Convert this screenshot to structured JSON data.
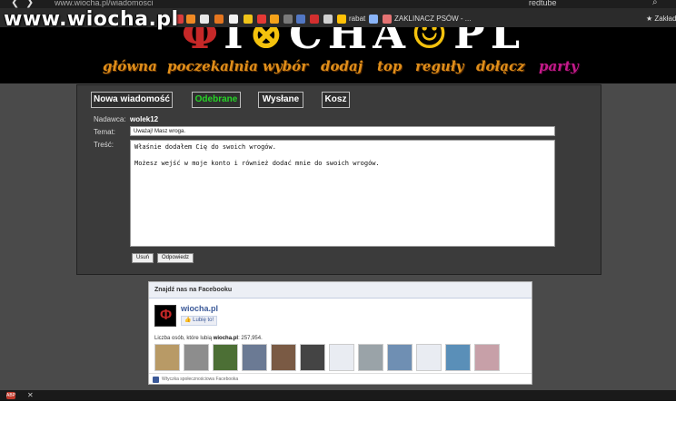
{
  "browser": {
    "url": "www.wiocha.pl/wiadomosci",
    "search_tab": "redtube",
    "bookmarks": [
      "rabat",
      "ZAKLINACZ PSÓW - ...",
      "Zakładki"
    ]
  },
  "watermark": "www.wiocha.pl",
  "site": {
    "nav": [
      "główna",
      "poczekalnia",
      "wybór",
      "dodaj",
      "top",
      "reguły",
      "dołącz",
      "party"
    ]
  },
  "messages": {
    "tabs": [
      "Nowa wiadomość",
      "Odebrane",
      "Wysłane",
      "Kosz"
    ],
    "sender_label": "Nadawca:",
    "sender": "wolek12",
    "subject_label": "Temat:",
    "subject": "Uważaj! Masz wroga.",
    "body_label": "Treść:",
    "body_line1": "Właśnie dodałem Cię do swoich wrogów.",
    "body_line2": "Możesz wejść w moje konto i również dodać mnie do swoich wrogów.",
    "delete_label": "Usuń",
    "reply_label": "Odpowiedz"
  },
  "facebook": {
    "header": "Znajdź nas na Facebooku",
    "page_name": "wiocha.pl",
    "like_label": "Lubię to!",
    "count_prefix": "Liczba osób, które lubią ",
    "count_page": "wiocha.pl",
    "count_value": ": 257,954.",
    "footer": "Wtyczka społecznościowa Facebooka"
  },
  "colors": {
    "nav": "#e08f1a",
    "nav_active": "#c41a8a",
    "selected_tab": "#27d327",
    "facebook_blue": "#3b5998"
  }
}
